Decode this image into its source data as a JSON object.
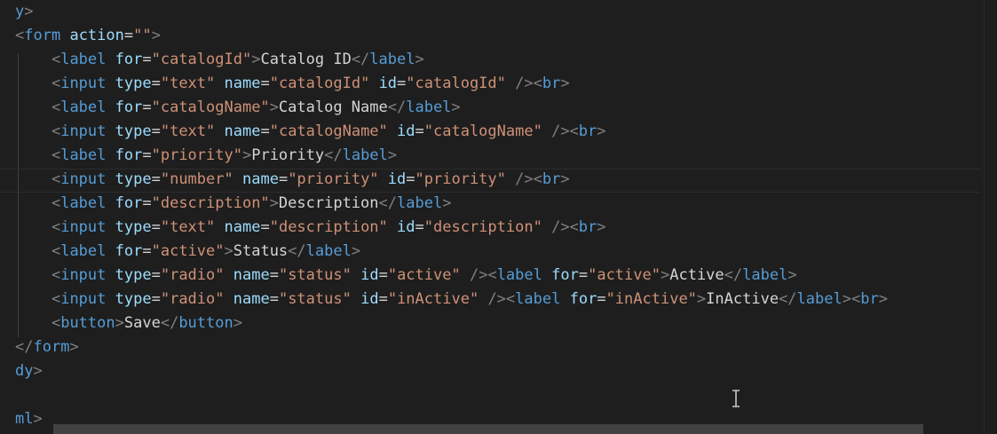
{
  "editor": {
    "lines": [
      [
        [
          "tag",
          "y"
        ],
        [
          "punc",
          ">"
        ]
      ],
      [
        [
          "punc",
          "<"
        ],
        [
          "tag",
          "form"
        ],
        [
          "text",
          " "
        ],
        [
          "attr",
          "action"
        ],
        [
          "eq",
          "="
        ],
        [
          "str",
          "\"\""
        ],
        [
          "punc",
          ">"
        ]
      ],
      [
        [
          "text",
          "    "
        ],
        [
          "punc",
          "<"
        ],
        [
          "tag",
          "label"
        ],
        [
          "text",
          " "
        ],
        [
          "attr",
          "for"
        ],
        [
          "eq",
          "="
        ],
        [
          "str",
          "\"catalogId\""
        ],
        [
          "punc",
          ">"
        ],
        [
          "text",
          "Catalog ID"
        ],
        [
          "punc",
          "</"
        ],
        [
          "tag",
          "label"
        ],
        [
          "punc",
          ">"
        ]
      ],
      [
        [
          "text",
          "    "
        ],
        [
          "punc",
          "<"
        ],
        [
          "tag",
          "input"
        ],
        [
          "text",
          " "
        ],
        [
          "attr",
          "type"
        ],
        [
          "eq",
          "="
        ],
        [
          "str",
          "\"text\""
        ],
        [
          "text",
          " "
        ],
        [
          "attr",
          "name"
        ],
        [
          "eq",
          "="
        ],
        [
          "str",
          "\"catalogId\""
        ],
        [
          "text",
          " "
        ],
        [
          "attr",
          "id"
        ],
        [
          "eq",
          "="
        ],
        [
          "str",
          "\"catalogId\""
        ],
        [
          "text",
          " "
        ],
        [
          "punc",
          "/><"
        ],
        [
          "tag",
          "br"
        ],
        [
          "punc",
          ">"
        ]
      ],
      [
        [
          "text",
          "    "
        ],
        [
          "punc",
          "<"
        ],
        [
          "tag",
          "label"
        ],
        [
          "text",
          " "
        ],
        [
          "attr",
          "for"
        ],
        [
          "eq",
          "="
        ],
        [
          "str",
          "\"catalogName\""
        ],
        [
          "punc",
          ">"
        ],
        [
          "text",
          "Catalog Name"
        ],
        [
          "punc",
          "</"
        ],
        [
          "tag",
          "label"
        ],
        [
          "punc",
          ">"
        ]
      ],
      [
        [
          "text",
          "    "
        ],
        [
          "punc",
          "<"
        ],
        [
          "tag",
          "input"
        ],
        [
          "text",
          " "
        ],
        [
          "attr",
          "type"
        ],
        [
          "eq",
          "="
        ],
        [
          "str",
          "\"text\""
        ],
        [
          "text",
          " "
        ],
        [
          "attr",
          "name"
        ],
        [
          "eq",
          "="
        ],
        [
          "str",
          "\"catalogName\""
        ],
        [
          "text",
          " "
        ],
        [
          "attr",
          "id"
        ],
        [
          "eq",
          "="
        ],
        [
          "str",
          "\"catalogName\""
        ],
        [
          "text",
          " "
        ],
        [
          "punc",
          "/><"
        ],
        [
          "tag",
          "br"
        ],
        [
          "punc",
          ">"
        ]
      ],
      [
        [
          "text",
          "    "
        ],
        [
          "punc",
          "<"
        ],
        [
          "tag",
          "label"
        ],
        [
          "text",
          " "
        ],
        [
          "attr",
          "for"
        ],
        [
          "eq",
          "="
        ],
        [
          "str",
          "\"priority\""
        ],
        [
          "punc",
          ">"
        ],
        [
          "text",
          "Priority"
        ],
        [
          "punc",
          "</"
        ],
        [
          "tag",
          "label"
        ],
        [
          "punc",
          ">"
        ]
      ],
      [
        [
          "text",
          "    "
        ],
        [
          "punc",
          "<"
        ],
        [
          "tag",
          "input"
        ],
        [
          "text",
          " "
        ],
        [
          "attr",
          "type"
        ],
        [
          "eq",
          "="
        ],
        [
          "str",
          "\"number\""
        ],
        [
          "text",
          " "
        ],
        [
          "attr",
          "name"
        ],
        [
          "eq",
          "="
        ],
        [
          "str",
          "\"priority\""
        ],
        [
          "text",
          " "
        ],
        [
          "attr",
          "id"
        ],
        [
          "eq",
          "="
        ],
        [
          "str",
          "\"priority\""
        ],
        [
          "text",
          " "
        ],
        [
          "punc",
          "/><"
        ],
        [
          "tag",
          "br"
        ],
        [
          "punc",
          ">"
        ]
      ],
      [
        [
          "text",
          "    "
        ],
        [
          "punc",
          "<"
        ],
        [
          "tag",
          "label"
        ],
        [
          "text",
          " "
        ],
        [
          "attr",
          "for"
        ],
        [
          "eq",
          "="
        ],
        [
          "str",
          "\"description\""
        ],
        [
          "punc",
          ">"
        ],
        [
          "text",
          "Description"
        ],
        [
          "punc",
          "</"
        ],
        [
          "tag",
          "label"
        ],
        [
          "punc",
          ">"
        ]
      ],
      [
        [
          "text",
          "    "
        ],
        [
          "punc",
          "<"
        ],
        [
          "tag",
          "input"
        ],
        [
          "text",
          " "
        ],
        [
          "attr",
          "type"
        ],
        [
          "eq",
          "="
        ],
        [
          "str",
          "\"text\""
        ],
        [
          "text",
          " "
        ],
        [
          "attr",
          "name"
        ],
        [
          "eq",
          "="
        ],
        [
          "str",
          "\"description\""
        ],
        [
          "text",
          " "
        ],
        [
          "attr",
          "id"
        ],
        [
          "eq",
          "="
        ],
        [
          "str",
          "\"description\""
        ],
        [
          "text",
          " "
        ],
        [
          "punc",
          "/><"
        ],
        [
          "tag",
          "br"
        ],
        [
          "punc",
          ">"
        ]
      ],
      [
        [
          "text",
          "    "
        ],
        [
          "punc",
          "<"
        ],
        [
          "tag",
          "label"
        ],
        [
          "text",
          " "
        ],
        [
          "attr",
          "for"
        ],
        [
          "eq",
          "="
        ],
        [
          "str",
          "\"active\""
        ],
        [
          "punc",
          ">"
        ],
        [
          "text",
          "Status"
        ],
        [
          "punc",
          "</"
        ],
        [
          "tag",
          "label"
        ],
        [
          "punc",
          ">"
        ]
      ],
      [
        [
          "text",
          "    "
        ],
        [
          "punc",
          "<"
        ],
        [
          "tag",
          "input"
        ],
        [
          "text",
          " "
        ],
        [
          "attr",
          "type"
        ],
        [
          "eq",
          "="
        ],
        [
          "str",
          "\"radio\""
        ],
        [
          "text",
          " "
        ],
        [
          "attr",
          "name"
        ],
        [
          "eq",
          "="
        ],
        [
          "str",
          "\"status\""
        ],
        [
          "text",
          " "
        ],
        [
          "attr",
          "id"
        ],
        [
          "eq",
          "="
        ],
        [
          "str",
          "\"active\""
        ],
        [
          "text",
          " "
        ],
        [
          "punc",
          "/><"
        ],
        [
          "tag",
          "label"
        ],
        [
          "text",
          " "
        ],
        [
          "attr",
          "for"
        ],
        [
          "eq",
          "="
        ],
        [
          "str",
          "\"active\""
        ],
        [
          "punc",
          ">"
        ],
        [
          "text",
          "Active"
        ],
        [
          "punc",
          "</"
        ],
        [
          "tag",
          "label"
        ],
        [
          "punc",
          ">"
        ]
      ],
      [
        [
          "text",
          "    "
        ],
        [
          "punc",
          "<"
        ],
        [
          "tag",
          "input"
        ],
        [
          "text",
          " "
        ],
        [
          "attr",
          "type"
        ],
        [
          "eq",
          "="
        ],
        [
          "str",
          "\"radio\""
        ],
        [
          "text",
          " "
        ],
        [
          "attr",
          "name"
        ],
        [
          "eq",
          "="
        ],
        [
          "str",
          "\"status\""
        ],
        [
          "text",
          " "
        ],
        [
          "attr",
          "id"
        ],
        [
          "eq",
          "="
        ],
        [
          "str",
          "\"inActive\""
        ],
        [
          "text",
          " "
        ],
        [
          "punc",
          "/><"
        ],
        [
          "tag",
          "label"
        ],
        [
          "text",
          " "
        ],
        [
          "attr",
          "for"
        ],
        [
          "eq",
          "="
        ],
        [
          "str",
          "\"inActive\""
        ],
        [
          "punc",
          ">"
        ],
        [
          "text",
          "InActive"
        ],
        [
          "punc",
          "</"
        ],
        [
          "tag",
          "label"
        ],
        [
          "punc",
          "><"
        ],
        [
          "tag",
          "br"
        ],
        [
          "punc",
          ">"
        ]
      ],
      [
        [
          "text",
          "    "
        ],
        [
          "punc",
          "<"
        ],
        [
          "tag",
          "button"
        ],
        [
          "punc",
          ">"
        ],
        [
          "text",
          "Save"
        ],
        [
          "punc",
          "</"
        ],
        [
          "tag",
          "button"
        ],
        [
          "punc",
          ">"
        ]
      ],
      [
        [
          "punc",
          "</"
        ],
        [
          "tag",
          "form"
        ],
        [
          "punc",
          ">"
        ]
      ],
      [
        [
          "tag",
          "dy"
        ],
        [
          "punc",
          ">"
        ]
      ],
      [],
      [
        [
          "tag",
          "ml"
        ],
        [
          "punc",
          ">"
        ]
      ]
    ]
  }
}
